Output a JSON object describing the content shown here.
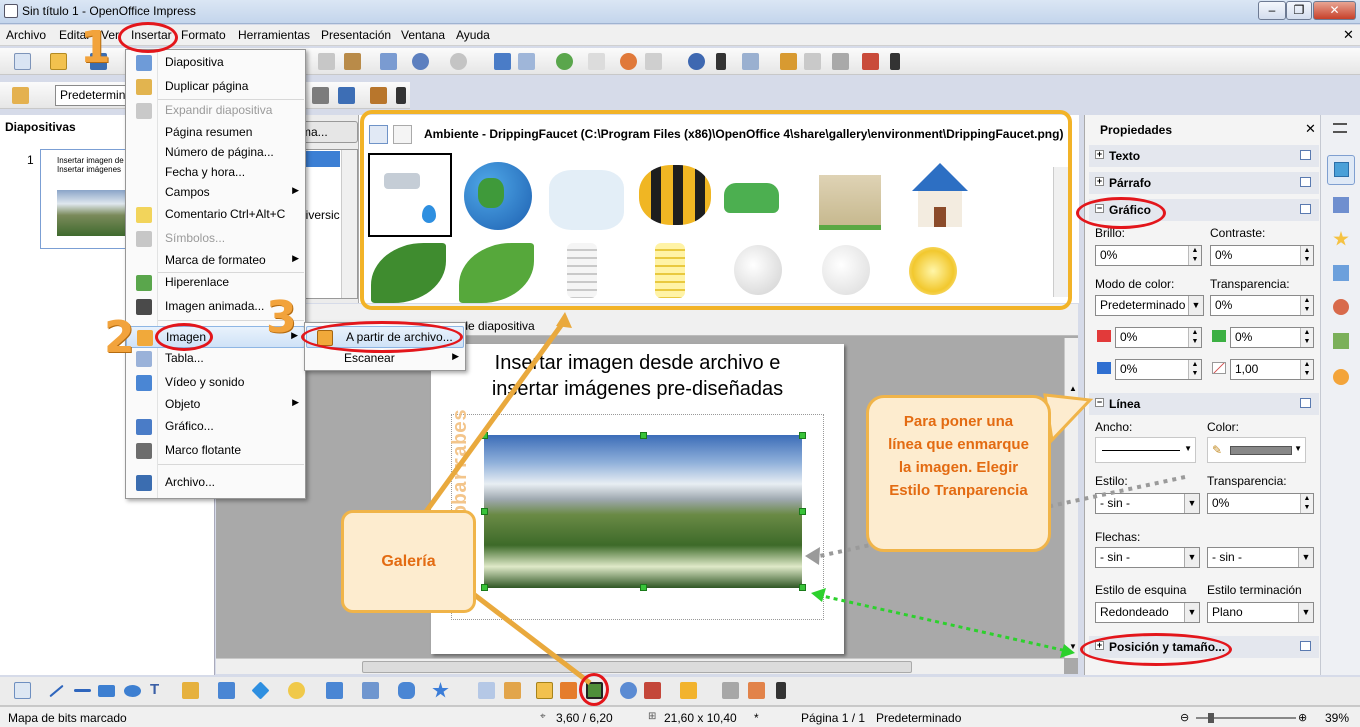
{
  "window": {
    "title": "Sin título 1 - OpenOffice Impress",
    "min": "–",
    "max": "❐",
    "close": "✕"
  },
  "menubar": [
    "Archivo",
    "Editar",
    "Ver",
    "Insertar",
    "Formato",
    "Herramientas",
    "Presentación",
    "Ventana",
    "Ayuda"
  ],
  "toolbar2": {
    "style_value": "Predeterminado"
  },
  "slides_panel": {
    "title": "Diapositivas",
    "slide_number": "1",
    "thumb_line1": "Insertar imagen de",
    "thumb_line2": "Insertar imágenes"
  },
  "insert_menu": [
    {
      "label": "Diapositiva",
      "shortcut": "",
      "disabled": false,
      "sub": false
    },
    {
      "label": "Duplicar página",
      "shortcut": "",
      "disabled": false,
      "sub": false
    },
    {
      "label": "Expandir diapositiva",
      "shortcut": "",
      "disabled": true,
      "sub": false
    },
    {
      "label": "Página resumen",
      "shortcut": "",
      "disabled": false,
      "sub": false
    },
    {
      "label": "Número de página...",
      "shortcut": "",
      "disabled": false,
      "sub": false
    },
    {
      "label": "Fecha y hora...",
      "shortcut": "",
      "disabled": false,
      "sub": false
    },
    {
      "label": "Campos",
      "shortcut": "",
      "disabled": false,
      "sub": true
    },
    {
      "label": "Comentario",
      "shortcut": "Ctrl+Alt+C",
      "disabled": false,
      "sub": false
    },
    {
      "label": "Símbolos...",
      "shortcut": "",
      "disabled": true,
      "sub": false
    },
    {
      "label": "Marca de formateo",
      "shortcut": "",
      "disabled": false,
      "sub": true
    },
    {
      "label": "Hiperenlace",
      "shortcut": "",
      "disabled": false,
      "sub": false
    },
    {
      "label": "Imagen animada...",
      "shortcut": "",
      "disabled": false,
      "sub": false
    },
    {
      "label": "Imagen",
      "shortcut": "",
      "disabled": false,
      "sub": true
    },
    {
      "label": "Tabla...",
      "shortcut": "",
      "disabled": false,
      "sub": false
    },
    {
      "label": "Vídeo y sonido",
      "shortcut": "",
      "disabled": false,
      "sub": false
    },
    {
      "label": "Objeto",
      "shortcut": "",
      "disabled": false,
      "sub": true
    },
    {
      "label": "Gráfico...",
      "shortcut": "",
      "disabled": false,
      "sub": false
    },
    {
      "label": "Marco flotante",
      "shortcut": "",
      "disabled": false,
      "sub": false
    },
    {
      "label": "Archivo...",
      "shortcut": "",
      "disabled": false,
      "sub": false
    }
  ],
  "image_submenu": [
    "A partir de archivo...",
    "Escanear"
  ],
  "gallery": {
    "tab_partial": "ma...",
    "list_partial": "niversic",
    "path": "Ambiente - DrippingFaucet (C:\\Program Files (x86)\\OpenOffice 4\\share\\gallery\\environment\\DrippingFaucet.png)"
  },
  "slide": {
    "tab_partial": "r de diapositiva",
    "title_line1": "Insertar imagen desde archivo e",
    "title_line2": "insertar imágenes pre-diseñadas",
    "watermark": "@claudiobarrabes"
  },
  "annotations": {
    "num1": "1",
    "num2": "2",
    "num3": "3",
    "galeria": "Galería",
    "linea_note": "Para poner una línea que enmarque la imagen. Elegir Estilo Tranparencia"
  },
  "properties": {
    "title": "Propiedades",
    "sections": {
      "texto": "Texto",
      "parrafo": "Párrafo",
      "grafico": "Gráfico",
      "linea": "Línea",
      "posicion": "Posición y tamaño..."
    },
    "grafico": {
      "brillo_label": "Brillo:",
      "brillo": "0%",
      "contraste_label": "Contraste:",
      "contraste": "0%",
      "modo_label": "Modo de color:",
      "modo": "Predeterminado",
      "transp_label": "Transparencia:",
      "transp": "0%",
      "red": "0%",
      "green": "0%",
      "blue": "0%",
      "gamma": "1,00"
    },
    "linea": {
      "ancho_label": "Ancho:",
      "color_label": "Color:",
      "estilo_label": "Estilo:",
      "estilo": "- sin -",
      "transp_label": "Transparencia:",
      "transp": "0%",
      "flechas_label": "Flechas:",
      "flecha1": "- sin -",
      "flecha2": "- sin -",
      "esquina_label": "Estilo de esquina",
      "esquina": "Redondeado",
      "terminacion_label": "Estilo terminación",
      "terminacion": "Plano"
    }
  },
  "status": {
    "mode": "Mapa de bits marcado",
    "pos": "3,60 / 6,20",
    "size": "21,60 x 10,40",
    "star": "*",
    "page": "Página 1 / 1",
    "layout": "Predeterminado",
    "zoom": "39%"
  }
}
